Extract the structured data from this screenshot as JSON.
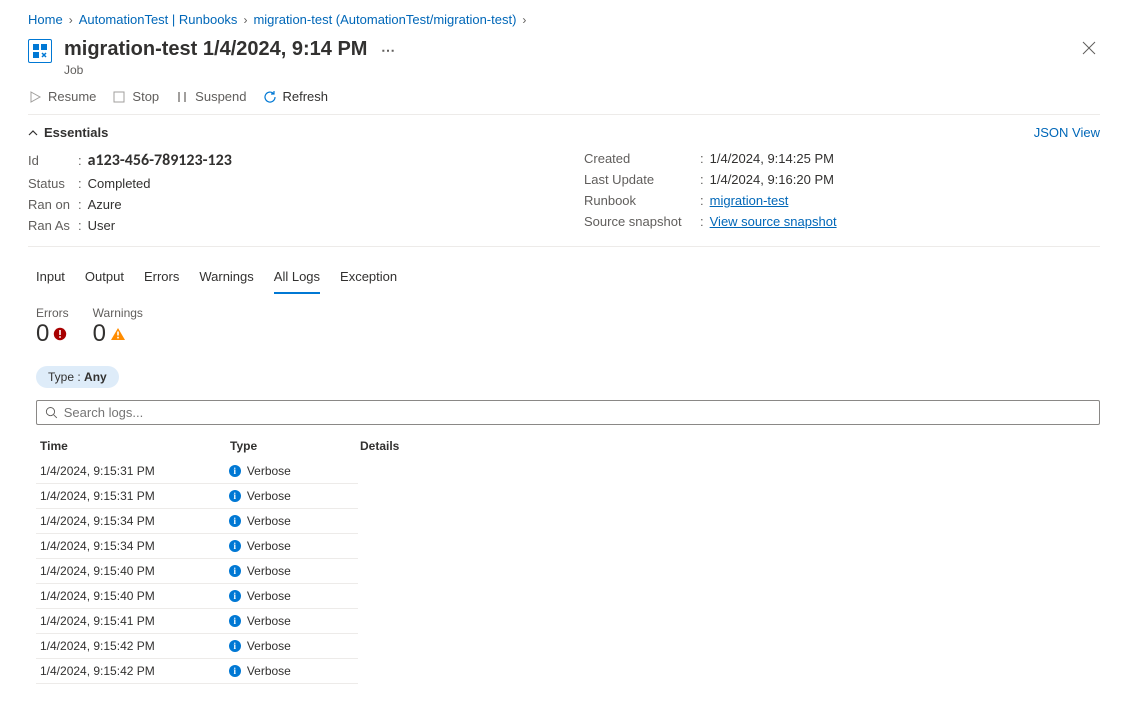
{
  "breadcrumb": [
    {
      "label": "Home"
    },
    {
      "label": "AutomationTest | Runbooks"
    },
    {
      "label": "migration-test (AutomationTest/migration-test)"
    }
  ],
  "header": {
    "title": "migration-test 1/4/2024, 9:14 PM",
    "subtitle": "Job",
    "more_glyph": "⋯"
  },
  "commands": {
    "resume": "Resume",
    "stop": "Stop",
    "suspend": "Suspend",
    "refresh": "Refresh"
  },
  "essentials": {
    "toggle_label": "Essentials",
    "json_view": "JSON View",
    "left": {
      "id_label": "Id",
      "id_value": "a123-456-789123-123",
      "status_label": "Status",
      "status_value": "Completed",
      "ranon_label": "Ran on",
      "ranon_value": "Azure",
      "ranas_label": "Ran As",
      "ranas_value": "User"
    },
    "right": {
      "created_label": "Created",
      "created_value": "1/4/2024, 9:14:25 PM",
      "lastupdate_label": "Last Update",
      "lastupdate_value": "1/4/2024, 9:16:20 PM",
      "runbook_label": "Runbook",
      "runbook_value": "migration-test",
      "snapshot_label": "Source snapshot",
      "snapshot_value": "View source snapshot"
    }
  },
  "tabs": {
    "input": "Input",
    "output": "Output",
    "errors": "Errors",
    "warnings": "Warnings",
    "alllogs": "All Logs",
    "exception": "Exception"
  },
  "counters": {
    "errors_label": "Errors",
    "errors_value": "0",
    "warnings_label": "Warnings",
    "warnings_value": "0"
  },
  "filter": {
    "prefix": "Type : ",
    "value": "Any"
  },
  "search": {
    "placeholder": "Search logs..."
  },
  "table": {
    "col_time": "Time",
    "col_type": "Type",
    "col_details": "Details",
    "rows": [
      {
        "time": "1/4/2024, 9:15:31 PM",
        "type": "Verbose"
      },
      {
        "time": "1/4/2024, 9:15:31 PM",
        "type": "Verbose"
      },
      {
        "time": "1/4/2024, 9:15:34 PM",
        "type": "Verbose"
      },
      {
        "time": "1/4/2024, 9:15:34 PM",
        "type": "Verbose"
      },
      {
        "time": "1/4/2024, 9:15:40 PM",
        "type": "Verbose"
      },
      {
        "time": "1/4/2024, 9:15:40 PM",
        "type": "Verbose"
      },
      {
        "time": "1/4/2024, 9:15:41 PM",
        "type": "Verbose"
      },
      {
        "time": "1/4/2024, 9:15:42 PM",
        "type": "Verbose"
      },
      {
        "time": "1/4/2024, 9:15:42 PM",
        "type": "Verbose"
      }
    ]
  }
}
